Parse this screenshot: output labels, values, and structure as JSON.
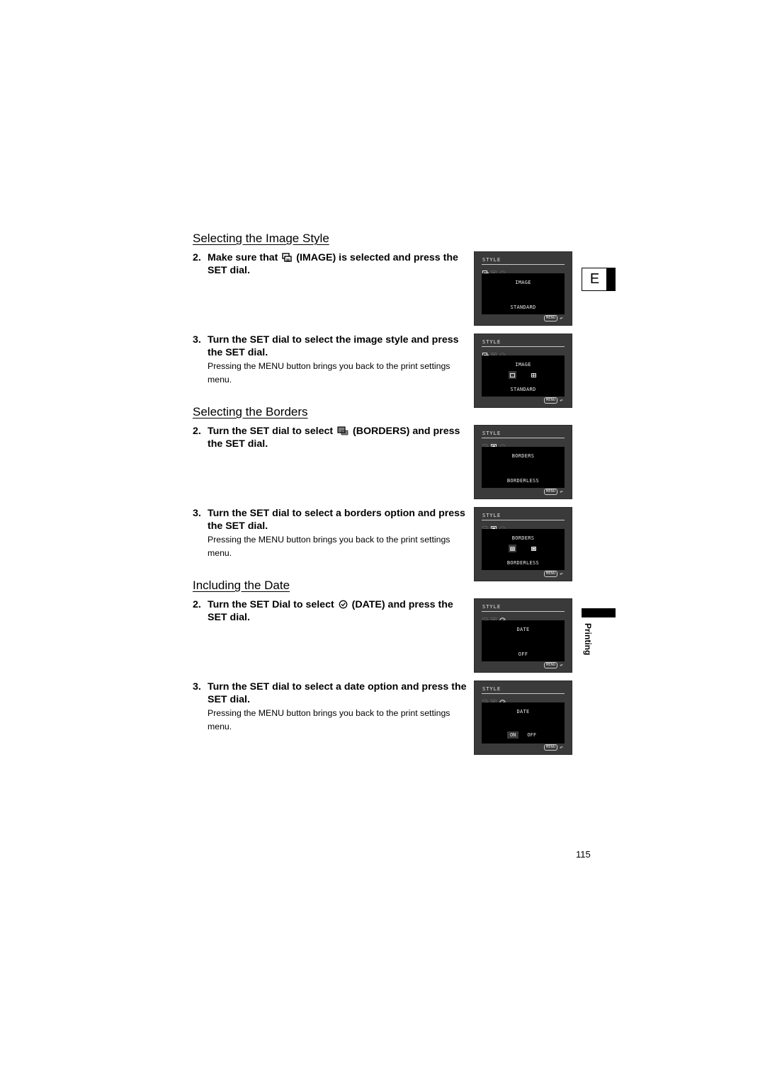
{
  "sections": [
    {
      "title": "Selecting the Image Style",
      "steps": [
        {
          "num": "2.",
          "pre": "Make sure that",
          "icon": "image-style-icon",
          "post": "(IMAGE) is selected and press the SET dial."
        },
        {
          "num": "3.",
          "text": "Turn the SET dial to select the image style and press the SET dial.",
          "note": "Pressing the MENU button brings you back to the print settings menu."
        }
      ]
    },
    {
      "title": "Selecting the Borders",
      "steps": [
        {
          "num": "2.",
          "pre": "Turn the SET dial to select",
          "icon": "borders-icon",
          "post": "(BORDERS) and press the SET dial."
        },
        {
          "num": "3.",
          "text": "Turn the SET dial to select a borders option and press the SET dial.",
          "note": "Pressing the MENU button brings you back to the print settings menu."
        }
      ]
    },
    {
      "title": "Including the Date",
      "steps": [
        {
          "num": "2.",
          "pre": "Turn the SET Dial to select",
          "icon": "date-clock-icon",
          "post": "(DATE) and press the SET dial."
        },
        {
          "num": "3.",
          "text": "Turn the SET dial to select a date option and press the SET dial.",
          "note": "Pressing the MENU button brings you back to the print settings menu."
        }
      ]
    }
  ],
  "screens": [
    {
      "title": "STYLE",
      "active_icon": "image",
      "label": "IMAGE",
      "value": "STANDARD",
      "menu": "MENU"
    },
    {
      "title": "STYLE",
      "active_icon": "image",
      "label": "IMAGE",
      "value": "STANDARD",
      "options": [
        "standard-frame",
        "grid"
      ],
      "selected_option": 0,
      "menu": "MENU"
    },
    {
      "title": "STYLE",
      "active_icon": "borders",
      "label": "BORDERS",
      "value": "BORDERLESS",
      "menu": "MENU"
    },
    {
      "title": "STYLE",
      "active_icon": "borders",
      "label": "BORDERS",
      "value": "BORDERLESS",
      "options": [
        "borderless",
        "bordered"
      ],
      "selected_option": 0,
      "menu": "MENU"
    },
    {
      "title": "STYLE",
      "active_icon": "date",
      "label": "DATE",
      "value": "OFF",
      "menu": "MENU"
    },
    {
      "title": "STYLE",
      "active_icon": "date",
      "label": "DATE",
      "onoff": [
        "ON",
        "OFF"
      ],
      "selected_option": 0,
      "menu": "MENU"
    }
  ],
  "side": {
    "language_tab": "E",
    "chapter": "Printing"
  },
  "page_number": "115"
}
